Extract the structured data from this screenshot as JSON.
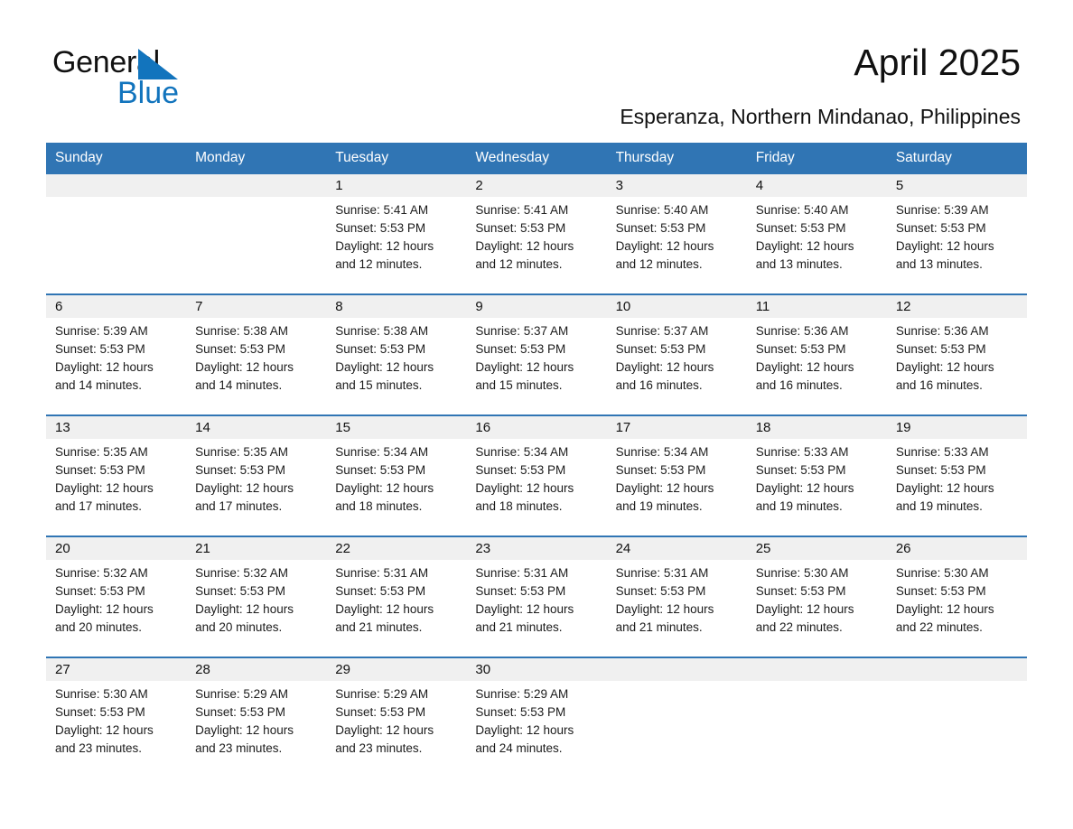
{
  "logo": {
    "word_general": "General",
    "word_blue": "Blue",
    "triangle_color": "#1274bd"
  },
  "header": {
    "title": "April 2025",
    "subtitle": "Esperanza, Northern Mindanao, Philippines",
    "accent_color": "#3075b4",
    "daynum_band_color": "#f0f0f0"
  },
  "calendar": {
    "weekday_headers": [
      "Sunday",
      "Monday",
      "Tuesday",
      "Wednesday",
      "Thursday",
      "Friday",
      "Saturday"
    ],
    "weeks": [
      [
        {
          "day": "",
          "sunrise": "",
          "sunset": "",
          "daylight_a": "",
          "daylight_b": ""
        },
        {
          "day": "",
          "sunrise": "",
          "sunset": "",
          "daylight_a": "",
          "daylight_b": ""
        },
        {
          "day": "1",
          "sunrise": "Sunrise: 5:41 AM",
          "sunset": "Sunset: 5:53 PM",
          "daylight_a": "Daylight: 12 hours",
          "daylight_b": "and 12 minutes."
        },
        {
          "day": "2",
          "sunrise": "Sunrise: 5:41 AM",
          "sunset": "Sunset: 5:53 PM",
          "daylight_a": "Daylight: 12 hours",
          "daylight_b": "and 12 minutes."
        },
        {
          "day": "3",
          "sunrise": "Sunrise: 5:40 AM",
          "sunset": "Sunset: 5:53 PM",
          "daylight_a": "Daylight: 12 hours",
          "daylight_b": "and 12 minutes."
        },
        {
          "day": "4",
          "sunrise": "Sunrise: 5:40 AM",
          "sunset": "Sunset: 5:53 PM",
          "daylight_a": "Daylight: 12 hours",
          "daylight_b": "and 13 minutes."
        },
        {
          "day": "5",
          "sunrise": "Sunrise: 5:39 AM",
          "sunset": "Sunset: 5:53 PM",
          "daylight_a": "Daylight: 12 hours",
          "daylight_b": "and 13 minutes."
        }
      ],
      [
        {
          "day": "6",
          "sunrise": "Sunrise: 5:39 AM",
          "sunset": "Sunset: 5:53 PM",
          "daylight_a": "Daylight: 12 hours",
          "daylight_b": "and 14 minutes."
        },
        {
          "day": "7",
          "sunrise": "Sunrise: 5:38 AM",
          "sunset": "Sunset: 5:53 PM",
          "daylight_a": "Daylight: 12 hours",
          "daylight_b": "and 14 minutes."
        },
        {
          "day": "8",
          "sunrise": "Sunrise: 5:38 AM",
          "sunset": "Sunset: 5:53 PM",
          "daylight_a": "Daylight: 12 hours",
          "daylight_b": "and 15 minutes."
        },
        {
          "day": "9",
          "sunrise": "Sunrise: 5:37 AM",
          "sunset": "Sunset: 5:53 PM",
          "daylight_a": "Daylight: 12 hours",
          "daylight_b": "and 15 minutes."
        },
        {
          "day": "10",
          "sunrise": "Sunrise: 5:37 AM",
          "sunset": "Sunset: 5:53 PM",
          "daylight_a": "Daylight: 12 hours",
          "daylight_b": "and 16 minutes."
        },
        {
          "day": "11",
          "sunrise": "Sunrise: 5:36 AM",
          "sunset": "Sunset: 5:53 PM",
          "daylight_a": "Daylight: 12 hours",
          "daylight_b": "and 16 minutes."
        },
        {
          "day": "12",
          "sunrise": "Sunrise: 5:36 AM",
          "sunset": "Sunset: 5:53 PM",
          "daylight_a": "Daylight: 12 hours",
          "daylight_b": "and 16 minutes."
        }
      ],
      [
        {
          "day": "13",
          "sunrise": "Sunrise: 5:35 AM",
          "sunset": "Sunset: 5:53 PM",
          "daylight_a": "Daylight: 12 hours",
          "daylight_b": "and 17 minutes."
        },
        {
          "day": "14",
          "sunrise": "Sunrise: 5:35 AM",
          "sunset": "Sunset: 5:53 PM",
          "daylight_a": "Daylight: 12 hours",
          "daylight_b": "and 17 minutes."
        },
        {
          "day": "15",
          "sunrise": "Sunrise: 5:34 AM",
          "sunset": "Sunset: 5:53 PM",
          "daylight_a": "Daylight: 12 hours",
          "daylight_b": "and 18 minutes."
        },
        {
          "day": "16",
          "sunrise": "Sunrise: 5:34 AM",
          "sunset": "Sunset: 5:53 PM",
          "daylight_a": "Daylight: 12 hours",
          "daylight_b": "and 18 minutes."
        },
        {
          "day": "17",
          "sunrise": "Sunrise: 5:34 AM",
          "sunset": "Sunset: 5:53 PM",
          "daylight_a": "Daylight: 12 hours",
          "daylight_b": "and 19 minutes."
        },
        {
          "day": "18",
          "sunrise": "Sunrise: 5:33 AM",
          "sunset": "Sunset: 5:53 PM",
          "daylight_a": "Daylight: 12 hours",
          "daylight_b": "and 19 minutes."
        },
        {
          "day": "19",
          "sunrise": "Sunrise: 5:33 AM",
          "sunset": "Sunset: 5:53 PM",
          "daylight_a": "Daylight: 12 hours",
          "daylight_b": "and 19 minutes."
        }
      ],
      [
        {
          "day": "20",
          "sunrise": "Sunrise: 5:32 AM",
          "sunset": "Sunset: 5:53 PM",
          "daylight_a": "Daylight: 12 hours",
          "daylight_b": "and 20 minutes."
        },
        {
          "day": "21",
          "sunrise": "Sunrise: 5:32 AM",
          "sunset": "Sunset: 5:53 PM",
          "daylight_a": "Daylight: 12 hours",
          "daylight_b": "and 20 minutes."
        },
        {
          "day": "22",
          "sunrise": "Sunrise: 5:31 AM",
          "sunset": "Sunset: 5:53 PM",
          "daylight_a": "Daylight: 12 hours",
          "daylight_b": "and 21 minutes."
        },
        {
          "day": "23",
          "sunrise": "Sunrise: 5:31 AM",
          "sunset": "Sunset: 5:53 PM",
          "daylight_a": "Daylight: 12 hours",
          "daylight_b": "and 21 minutes."
        },
        {
          "day": "24",
          "sunrise": "Sunrise: 5:31 AM",
          "sunset": "Sunset: 5:53 PM",
          "daylight_a": "Daylight: 12 hours",
          "daylight_b": "and 21 minutes."
        },
        {
          "day": "25",
          "sunrise": "Sunrise: 5:30 AM",
          "sunset": "Sunset: 5:53 PM",
          "daylight_a": "Daylight: 12 hours",
          "daylight_b": "and 22 minutes."
        },
        {
          "day": "26",
          "sunrise": "Sunrise: 5:30 AM",
          "sunset": "Sunset: 5:53 PM",
          "daylight_a": "Daylight: 12 hours",
          "daylight_b": "and 22 minutes."
        }
      ],
      [
        {
          "day": "27",
          "sunrise": "Sunrise: 5:30 AM",
          "sunset": "Sunset: 5:53 PM",
          "daylight_a": "Daylight: 12 hours",
          "daylight_b": "and 23 minutes."
        },
        {
          "day": "28",
          "sunrise": "Sunrise: 5:29 AM",
          "sunset": "Sunset: 5:53 PM",
          "daylight_a": "Daylight: 12 hours",
          "daylight_b": "and 23 minutes."
        },
        {
          "day": "29",
          "sunrise": "Sunrise: 5:29 AM",
          "sunset": "Sunset: 5:53 PM",
          "daylight_a": "Daylight: 12 hours",
          "daylight_b": "and 23 minutes."
        },
        {
          "day": "30",
          "sunrise": "Sunrise: 5:29 AM",
          "sunset": "Sunset: 5:53 PM",
          "daylight_a": "Daylight: 12 hours",
          "daylight_b": "and 24 minutes."
        },
        {
          "day": "",
          "sunrise": "",
          "sunset": "",
          "daylight_a": "",
          "daylight_b": ""
        },
        {
          "day": "",
          "sunrise": "",
          "sunset": "",
          "daylight_a": "",
          "daylight_b": ""
        },
        {
          "day": "",
          "sunrise": "",
          "sunset": "",
          "daylight_a": "",
          "daylight_b": ""
        }
      ]
    ]
  }
}
